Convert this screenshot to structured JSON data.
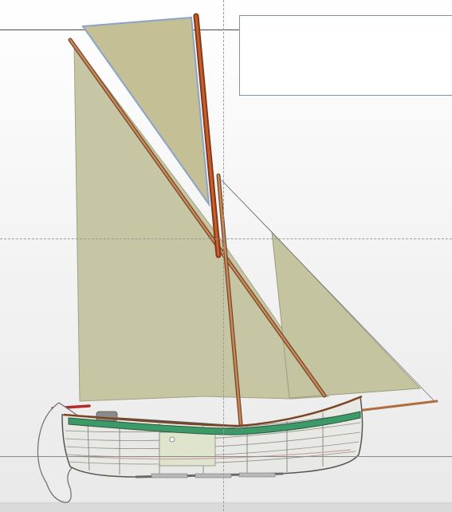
{
  "canvas": {
    "background": "#ffffff",
    "guide_color": "#9a9a9a"
  },
  "info_panel": {
    "text": ""
  },
  "colors": {
    "sail": "#c4c4a0",
    "topsail": "#c5bf96",
    "spar": "#b06d40",
    "mast": "#a24a1e",
    "gunwale_stripe": "#3c9a68",
    "hull_fill": "#e8e8e4",
    "hull_outline": "#555555",
    "waterline": "#c9a7a7",
    "rudder": "#ececec",
    "bowsprit_red": "#b22a2a"
  },
  "icons": {
    "mainsail": "sail-shape",
    "topsail": "sail-shape",
    "jib": "sail-shape",
    "hull": "boat-hull"
  }
}
